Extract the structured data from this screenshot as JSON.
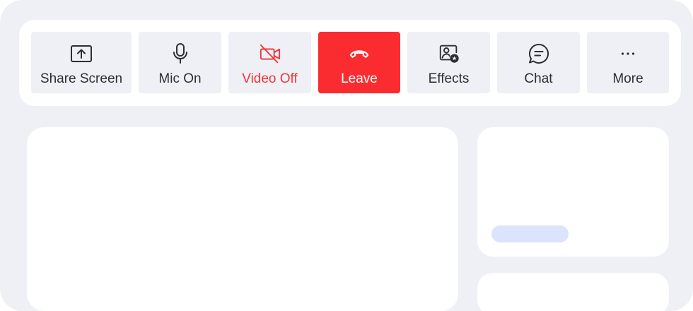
{
  "toolbar": {
    "buttons": [
      {
        "label": "Share Screen",
        "icon": "share-screen-icon"
      },
      {
        "label": "Mic On",
        "icon": "microphone-icon"
      },
      {
        "label": "Video Off",
        "icon": "video-off-icon",
        "color": "#f0353b"
      },
      {
        "label": "Leave",
        "icon": "hang-up-icon",
        "color": "#fb2c2f"
      },
      {
        "label": "Effects",
        "icon": "effects-icon"
      },
      {
        "label": "Chat",
        "icon": "chat-icon"
      },
      {
        "label": "More",
        "icon": "more-dots-icon"
      }
    ]
  },
  "colors": {
    "background": "#eef0f5",
    "surface": "#ffffff",
    "danger": "#fb2c2f",
    "text": "#2b2f36",
    "name_pill": "#dbe4fb"
  }
}
